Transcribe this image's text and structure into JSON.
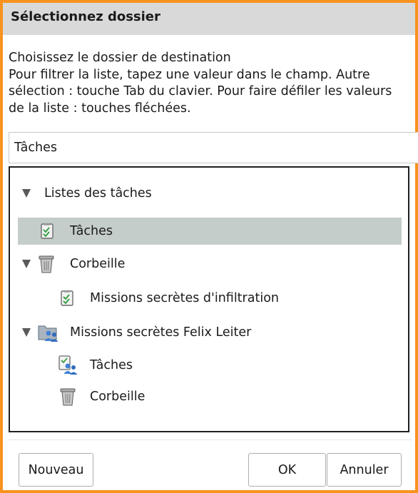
{
  "dialog": {
    "title": "Sélectionnez dossier",
    "instructions": {
      "line1": "Choisissez le dossier de destination",
      "line2": "Pour filtrer la liste, tapez une valeur dans le champ. Autre",
      "line3": "sélection : touche Tab du clavier. Pour faire défiler les valeurs",
      "line4": "de la liste : touches fléchées."
    },
    "filter_value": "Tâches",
    "tree": {
      "root": "Listes des tâches",
      "taches": "Tâches",
      "corbeille": "Corbeille",
      "missions_infiltration": "Missions secrètes d'infiltration",
      "felix_leiter": "Missions secrètes Felix Leiter",
      "felix_taches": "Tâches",
      "felix_corbeille": "Corbeille"
    },
    "buttons": {
      "new": "Nouveau",
      "ok": "OK",
      "cancel": "Annuler"
    },
    "colors": {
      "frame": "#f7931e",
      "titlebar": "#d9d9d9",
      "selection": "#c4cdc9"
    }
  }
}
